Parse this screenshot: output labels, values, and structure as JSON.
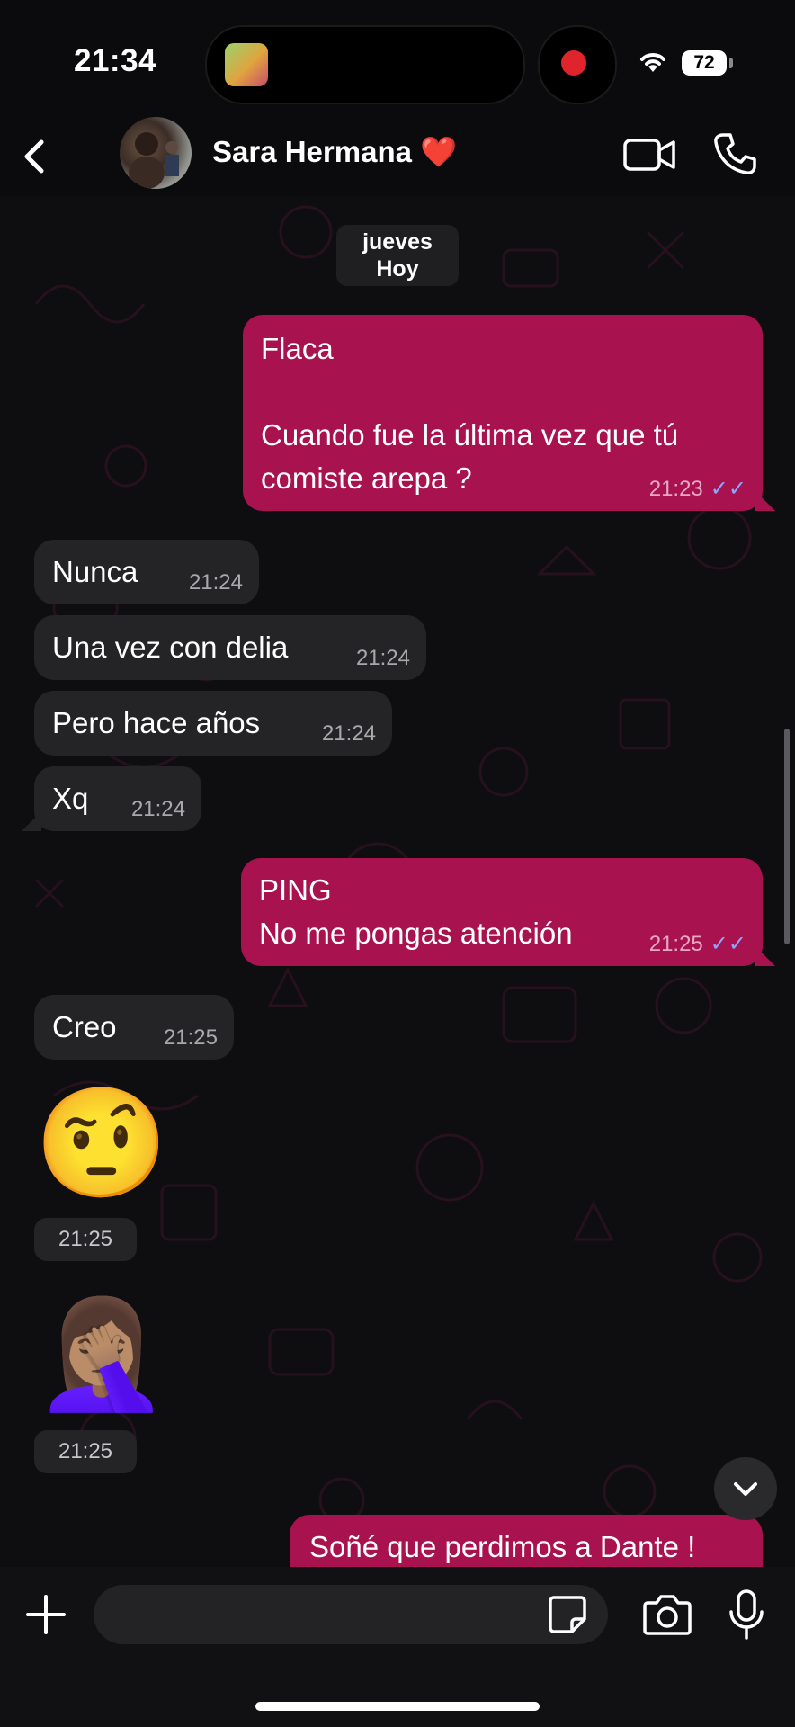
{
  "status_bar": {
    "time": "21:34",
    "battery": "72"
  },
  "header": {
    "contact_name": "Sara Hermana ❤️"
  },
  "day_chip": {
    "line1": "jueves",
    "line2": "Hoy"
  },
  "messages": [
    {
      "dir": "out",
      "text": "Flaca\n\nCuando fue la última vez que tú comiste arepa ?",
      "time": "21:23",
      "ticks": "✓✓"
    },
    {
      "dir": "in",
      "text": "Nunca",
      "time": "21:24"
    },
    {
      "dir": "in",
      "text": "Una vez con delia",
      "time": "21:24"
    },
    {
      "dir": "in",
      "text": "Pero hace años",
      "time": "21:24"
    },
    {
      "dir": "in",
      "text": "Xq",
      "time": "21:24"
    },
    {
      "dir": "out",
      "text": "PING\nNo me pongas atención",
      "time": "21:25",
      "ticks": "✓✓"
    },
    {
      "dir": "in",
      "text": "Creo",
      "time": "21:25"
    },
    {
      "dir": "in",
      "emoji": "🤨",
      "time": "21:25"
    },
    {
      "dir": "in",
      "emoji": "🤦🏽‍♀️",
      "time": "21:25"
    },
    {
      "dir": "out",
      "text": "Soñé que perdimos a Dante !"
    }
  ],
  "composer": {
    "placeholder": ""
  },
  "colors": {
    "outgoing": "#a8124f",
    "incoming": "#242427",
    "read_ticks": "#8ea5ff"
  }
}
